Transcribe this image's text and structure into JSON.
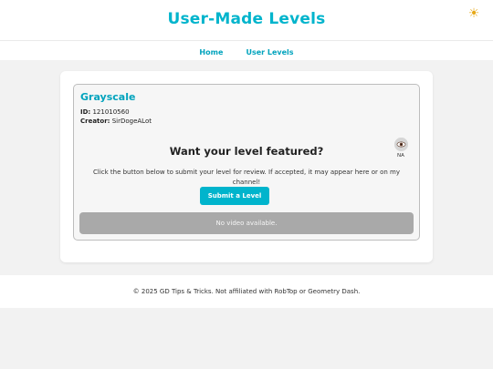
{
  "header": {
    "title": "User-Made Levels",
    "theme_icon": "sun-icon"
  },
  "nav": {
    "items": [
      {
        "label": "Home"
      },
      {
        "label": "User Levels"
      }
    ]
  },
  "level": {
    "name": "Grayscale",
    "id_label": "ID:",
    "id_value": "121010560",
    "creator_label": "Creator:",
    "creator_value": "SirDogeALot",
    "views_label": "NA",
    "views_icon": "eye-icon"
  },
  "feature": {
    "heading": "Want your level featured?",
    "text": "Click the button below to submit your level for review. If accepted, it may appear here or on my channel!",
    "button_label": "Submit a Level"
  },
  "video": {
    "message": "No video available."
  },
  "footer": {
    "text": "© 2025 GD Tips & Tricks. Not affiliated with RobTop or Geometry Dash."
  },
  "colors": {
    "accent": "#00b4cc",
    "page_bg": "#f2f2f2",
    "video_placeholder": "#a9a9a9"
  }
}
